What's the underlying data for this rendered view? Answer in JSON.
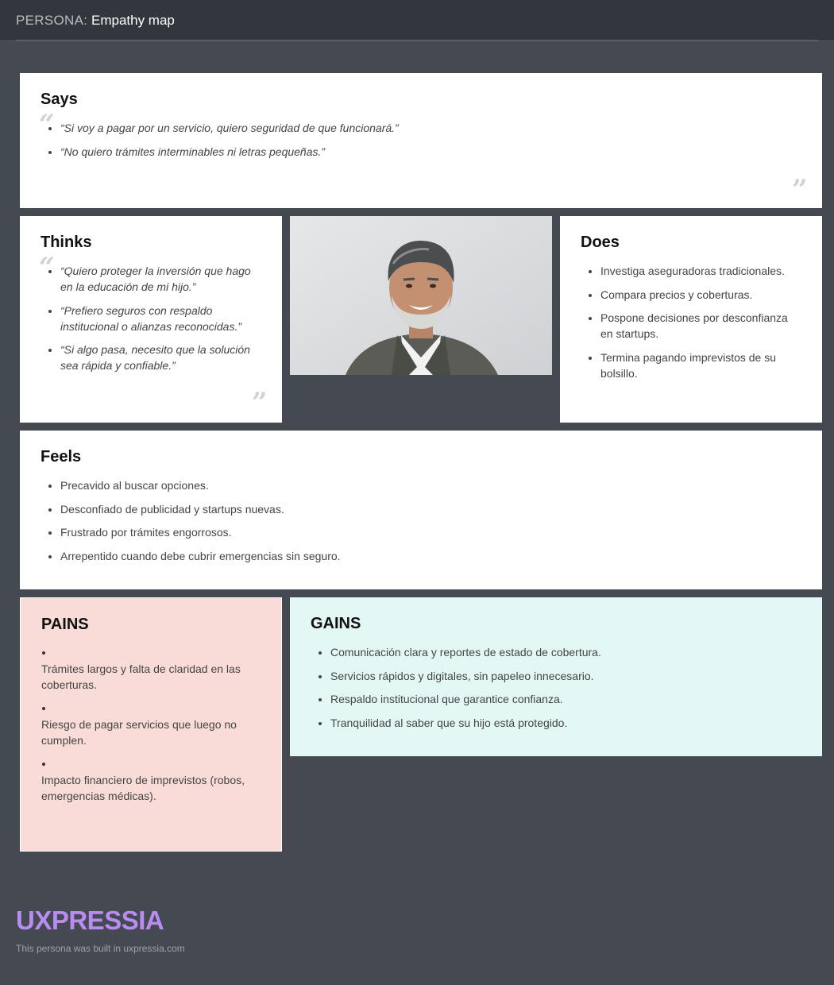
{
  "header": {
    "prefix": "PERSONA:",
    "title": "Empathy map"
  },
  "says": {
    "title": "Says",
    "items": [
      "“Si voy a pagar por un servicio, quiero seguridad de que funcionará.”",
      "“No quiero trámites interminables ni letras pequeñas.”"
    ]
  },
  "thinks": {
    "title": "Thinks",
    "items": [
      "“Quiero proteger la inversión que hago en la educación de mi hijo.”",
      "“Prefiero seguros con respaldo institucional o alianzas reconocidas.”",
      "“Si algo pasa, necesito que la solución sea rápida y confiable.”"
    ]
  },
  "does": {
    "title": "Does",
    "items": [
      "Investiga aseguradoras tradicionales.",
      "Compara precios y coberturas.",
      "Pospone decisiones por desconfianza en startups.",
      "Termina pagando imprevistos de su bolsillo."
    ]
  },
  "feels": {
    "title": "Feels",
    "items": [
      "Precavido al buscar opciones.",
      "Desconfiado de publicidad y startups nuevas.",
      "Frustrado por trámites engorrosos.",
      "Arrepentido cuando debe cubrir emergencias sin seguro."
    ]
  },
  "pains": {
    "title": "PAINS",
    "items": [
      "Trámites largos y falta de claridad en las coberturas.",
      "Riesgo de pagar servicios que luego no cumplen.",
      "Impacto financiero de imprevistos (robos, emergencias médicas)."
    ]
  },
  "gains": {
    "title": "GAINS",
    "items": [
      "Comunicación clara y reportes de estado de cobertura.",
      "Servicios rápidos y digitales, sin papeleo innecesario.",
      "Respaldo institucional que garantice confianza.",
      "Tranquilidad al saber que su hijo está protegido."
    ]
  },
  "footer": {
    "logo": "UXPRESSIA",
    "text": "This persona was built in uxpressia.com"
  },
  "quote_marks": {
    "open": "“",
    "close": "”"
  },
  "colors": {
    "background": "#454a52",
    "pains_bg": "#f9dcd8",
    "gains_bg": "#e3f8f4",
    "logo": "#b88cf0"
  }
}
